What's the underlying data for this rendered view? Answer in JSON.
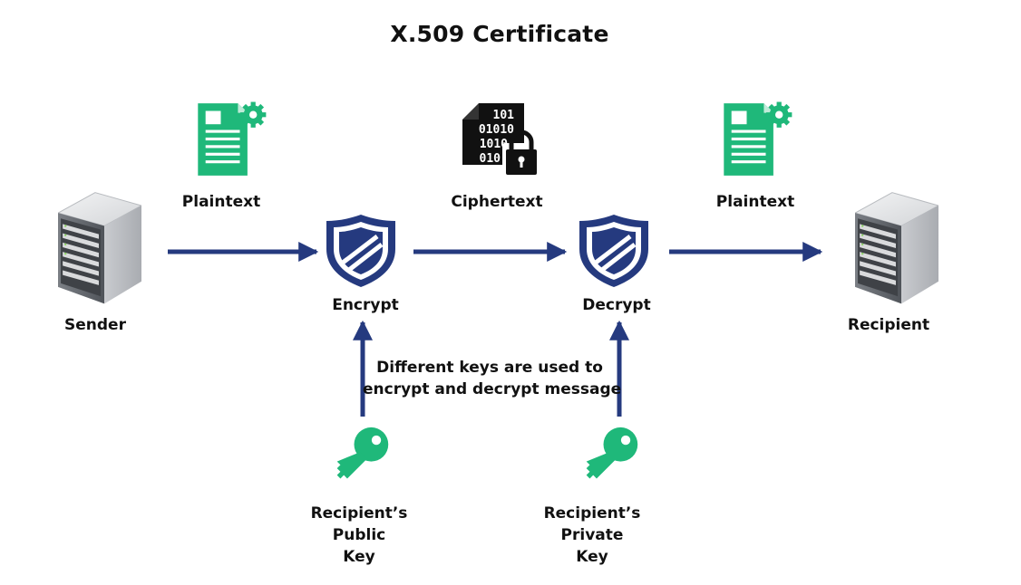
{
  "title": "X.509 Certificate",
  "nodes": {
    "sender": {
      "label": "Sender",
      "icon": "server-icon"
    },
    "recipient": {
      "label": "Recipient",
      "icon": "server-icon"
    },
    "plaintext_in": {
      "label": "Plaintext",
      "icon": "document-gear-icon"
    },
    "ciphertext": {
      "label": "Ciphertext",
      "icon": "binary-document-lock-icon",
      "binary_rows": [
        "101",
        "01010",
        "1010",
        "010"
      ]
    },
    "plaintext_out": {
      "label": "Plaintext",
      "icon": "document-gear-icon"
    },
    "encrypt": {
      "label": "Encrypt",
      "icon": "shield-icon"
    },
    "decrypt": {
      "label": "Decrypt",
      "icon": "shield-icon"
    }
  },
  "keys": {
    "public": {
      "lines": [
        "Recipient’s",
        "Public",
        "Key"
      ],
      "icon": "key-icon"
    },
    "private": {
      "lines": [
        "Recipient’s",
        "Private",
        "Key"
      ],
      "icon": "key-icon"
    }
  },
  "note": {
    "lines": [
      "Different keys are used to",
      "encrypt and decrypt message"
    ]
  },
  "colors": {
    "navy": "#253a7f",
    "green": "#1fb87a",
    "black": "#111111",
    "server_light": "#d8d9dc",
    "server_dark": "#6f7378"
  }
}
